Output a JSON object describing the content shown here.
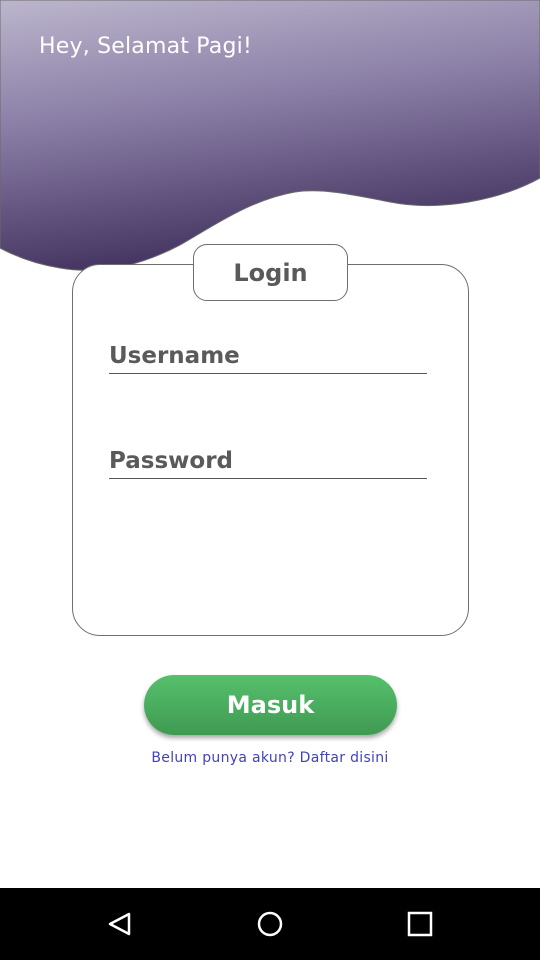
{
  "header": {
    "greeting": "Hey, Selamat Pagi!",
    "gradient_top": "#b8b2c8",
    "gradient_bottom": "#4a3a6a"
  },
  "login": {
    "title": "Login",
    "username_placeholder": "Username",
    "password_placeholder": "Password",
    "submit_label": "Masuk",
    "submit_color": "#4caf60"
  },
  "register": {
    "link_text": "Belum punya akun? Daftar disini",
    "link_color": "#4343b8"
  },
  "navbar": {
    "buttons": [
      "back-icon",
      "home-icon",
      "recent-apps-icon"
    ]
  }
}
